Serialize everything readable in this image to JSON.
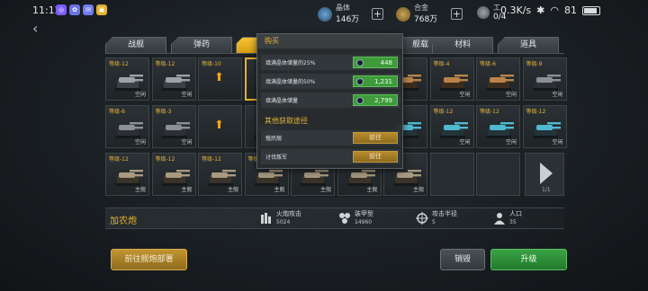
{
  "status_bar": {
    "time": "11:12",
    "network_speed": "0.3K/s",
    "battery": "81",
    "app_icons": [
      {
        "name": "app-icon-1",
        "glyph": "◎",
        "color": "#7c5cff"
      },
      {
        "name": "app-icon-2",
        "glyph": "✿",
        "color": "#6a74e8"
      },
      {
        "name": "app-icon-3",
        "glyph": "✉",
        "color": "#6f7cf0"
      },
      {
        "name": "app-icon-4",
        "glyph": "▣",
        "color": "#e1b236"
      }
    ]
  },
  "resources": {
    "crystal": {
      "label": "晶体",
      "value": "146万"
    },
    "alloy": {
      "label": "合金",
      "value": "768万"
    },
    "worker": {
      "label": "工",
      "value": "0/4"
    }
  },
  "tabs": [
    "战舰",
    "弹药",
    "",
    "",
    "舰载",
    "材料",
    "道具"
  ],
  "active_tab_index": 2,
  "grid": [
    {
      "level": "等级-12",
      "status": "空闲",
      "type": "cannon"
    },
    {
      "level": "等级-12",
      "status": "空闲",
      "type": "cannon"
    },
    {
      "level": "等级-10",
      "status": "",
      "type": "upgrade"
    },
    {
      "level": "",
      "status": "",
      "type": "cannon-selected"
    },
    {
      "level": "",
      "status": "",
      "type": "hidden"
    },
    {
      "level": "",
      "status": "",
      "type": "hidden"
    },
    {
      "level": "",
      "status": "",
      "type": "bronze"
    },
    {
      "level": "等级-4",
      "status": "空闲",
      "type": "bronze"
    },
    {
      "level": "等级-6",
      "status": "空闲",
      "type": "bronze"
    },
    {
      "level": "等级-9",
      "status": "空闲",
      "type": "dark"
    },
    {
      "level": "等级-6",
      "status": "空闲",
      "type": "dark"
    },
    {
      "level": "等级-3",
      "status": "空闲",
      "type": "dark"
    },
    {
      "level": "",
      "status": "",
      "type": "upgrade"
    },
    {
      "level": "",
      "status": "",
      "type": "dark"
    },
    {
      "level": "",
      "status": "",
      "type": "hidden"
    },
    {
      "level": "",
      "status": "",
      "type": "hidden"
    },
    {
      "level": "",
      "status": "",
      "type": "cyan"
    },
    {
      "level": "等级-12",
      "status": "空闲",
      "type": "cyan"
    },
    {
      "level": "等级-12",
      "status": "空闲",
      "type": "cyan"
    },
    {
      "level": "等级-12",
      "status": "空闲",
      "type": "cyan"
    },
    {
      "level": "等级-12",
      "status": "主舰",
      "type": "long"
    },
    {
      "level": "等级-12",
      "status": "主舰",
      "type": "long"
    },
    {
      "level": "等级-12",
      "status": "主舰",
      "type": "long"
    },
    {
      "level": "等级-12",
      "status": "主舰",
      "type": "long"
    },
    {
      "level": "等级-12",
      "status": "主舰",
      "type": "long"
    },
    {
      "level": "",
      "status": "主舰",
      "type": "long"
    },
    {
      "level": "",
      "status": "主舰",
      "type": "long"
    },
    {
      "level": "",
      "status": "",
      "type": "empty"
    },
    {
      "level": "",
      "status": "",
      "type": "empty"
    }
  ],
  "page_indicator": "1/1",
  "popup": {
    "title": "购买",
    "rows": [
      {
        "label": "填满晶体储量的25%",
        "cost": "448"
      },
      {
        "label": "填满晶体储量的50%",
        "cost": "1,231"
      },
      {
        "label": "填满晶体储量",
        "cost": "2,799"
      }
    ],
    "other_title": "其他获取途径",
    "other_rows": [
      {
        "label": "殖民舰",
        "button": "前往"
      },
      {
        "label": "讨伐叛军",
        "button": "前往"
      }
    ]
  },
  "info": {
    "gun_name": "加农炮",
    "stats": [
      {
        "label": "火炮攻击",
        "value": "5024",
        "icon": "ammo-icon"
      },
      {
        "label": "装甲型",
        "value": "14960",
        "icon": "armor-icon"
      },
      {
        "label": "攻击半径",
        "value": "5",
        "icon": "crosshair-icon"
      },
      {
        "label": "人口",
        "value": "35",
        "icon": "population-icon"
      }
    ]
  },
  "buttons": {
    "deploy": "前往舰炮部署",
    "destroy": "销毁",
    "upgrade": "升级"
  },
  "colors": {
    "accent_gold": "#e7b12c",
    "buy_green": "#3f9a3b",
    "upgrade_green": "#3ba245"
  }
}
